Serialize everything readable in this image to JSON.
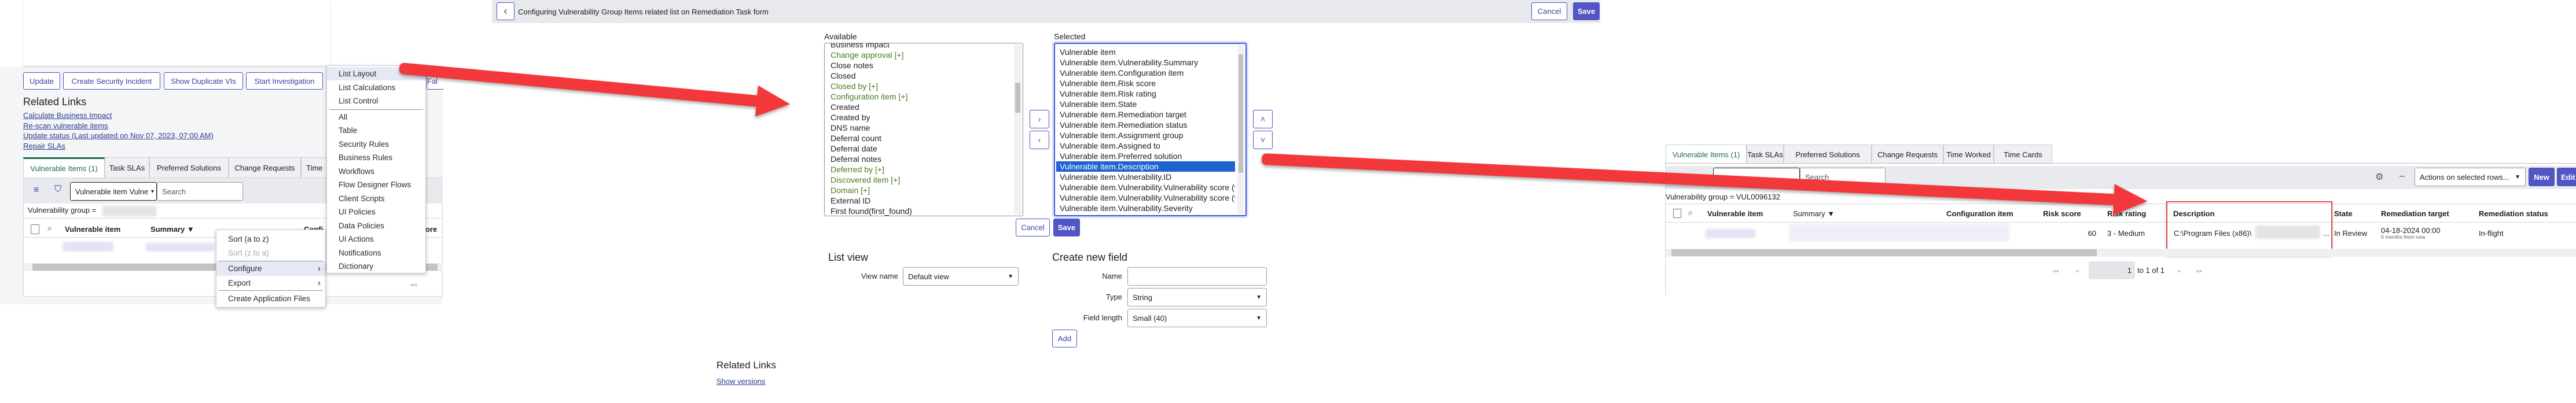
{
  "colors": {
    "accent": "#5256c4",
    "link": "#2d3b8e",
    "active_tab": "#1f6b4f",
    "reference_field": "#4b7a1e",
    "selection": "#1e63cf",
    "annotation": "#f2373b"
  },
  "left_panel": {
    "buttons": [
      "Update",
      "Create Security Incident",
      "Show Duplicate VIs",
      "Start Investigation",
      "Fal"
    ],
    "related_links_heading": "Related Links",
    "related_links": [
      "Calculate Business Impact",
      "Re-scan vulnerable items",
      "Update status (Last updated on Nov 07, 2023, 07:00 AM)",
      "Repair SLAs"
    ],
    "tabs": [
      "Vulnerable Items (1)",
      "Task SLAs",
      "Preferred Solutions",
      "Change Requests",
      "Time"
    ],
    "search_field": "Vulnerable item Vulne",
    "search_placeholder": "Search",
    "filter_label": "Vulnerability group =",
    "columns": [
      "Vulnerable item",
      "Summary ▼",
      "Confi",
      "ore"
    ],
    "context_menu": {
      "items": [
        "Sort (a to z)",
        "Sort (z to a)",
        "Configure",
        "Export",
        "Create Application Files"
      ],
      "chevron": "›"
    },
    "submenu": {
      "items": [
        "List Layout",
        "List Calculations",
        "List Control",
        "All",
        "Table",
        "Security Rules",
        "Business Rules",
        "Workflows",
        "Flow Designer Flows",
        "Client Scripts",
        "UI Policies",
        "Data Policies",
        "UI Actions",
        "Notifications",
        "Dictionary"
      ]
    }
  },
  "config_panel": {
    "back_icon": "‹",
    "title": "Configuring Vulnerability Group Items related list on Remediation Task form",
    "cancel": "Cancel",
    "save": "Save",
    "available_label": "Available",
    "available": [
      {
        "label": "Business impact",
        "ref": false
      },
      {
        "label": "Change approval [+]",
        "ref": true
      },
      {
        "label": "Close notes",
        "ref": false
      },
      {
        "label": "Closed",
        "ref": false
      },
      {
        "label": "Closed by [+]",
        "ref": true
      },
      {
        "label": "Configuration item [+]",
        "ref": true
      },
      {
        "label": "Created",
        "ref": false
      },
      {
        "label": "Created by",
        "ref": false
      },
      {
        "label": "DNS name",
        "ref": false
      },
      {
        "label": "Deferral count",
        "ref": false
      },
      {
        "label": "Deferral date",
        "ref": false
      },
      {
        "label": "Deferral notes",
        "ref": false
      },
      {
        "label": "Deferred by [+]",
        "ref": true
      },
      {
        "label": "Discovered item [+]",
        "ref": true
      },
      {
        "label": "Domain [+]",
        "ref": true
      },
      {
        "label": "External ID",
        "ref": false
      },
      {
        "label": "First found(first_found)",
        "ref": false
      }
    ],
    "selected_label": "Selected",
    "selected": [
      "Vulnerable item",
      "Vulnerable item.Vulnerability.Summary",
      "Vulnerable item.Configuration item",
      "Vulnerable item.Risk score",
      "Vulnerable item.Risk rating",
      "Vulnerable item.State",
      "Vulnerable item.Remediation target",
      "Vulnerable item.Remediation status",
      "Vulnerable item.Assignment group",
      "Vulnerable item.Assigned to",
      "Vulnerable item.Preferred solution",
      "Vulnerable item.Description",
      "Vulnerable item.Vulnerability.ID",
      "Vulnerable item.Vulnerability.Vulnerability score (v",
      "Vulnerable item.Vulnerability.Vulnerability score (v",
      "Vulnerable item.Vulnerability.Severity"
    ],
    "selected_index": 11,
    "move_right": "›",
    "move_left": "‹",
    "move_up": "˄",
    "move_down": "˅",
    "list_view_heading": "List view",
    "view_name_label": "View name",
    "view_name_value": "Default view",
    "create_field_heading": "Create new field",
    "name_label": "Name",
    "name_value": "",
    "type_label": "Type",
    "type_value": "String",
    "field_length_label": "Field length",
    "field_length_value": "Small (40)",
    "add": "Add",
    "related_links_heading": "Related Links",
    "show_versions": "Show versions"
  },
  "result_panel": {
    "tabs": [
      "Vulnerable Items (1)",
      "Task SLAs",
      "Preferred Solutions",
      "Change Requests",
      "Time Worked",
      "Time Cards"
    ],
    "search_placeholder": "Search",
    "actions_select": "Actions on selected rows...",
    "new": "New",
    "edit": "Edit",
    "filter_label": "Vulnerability group = VUL0096132",
    "columns": [
      "Vulnerable item",
      "Summary ▼",
      "Configuration item",
      "Risk score",
      "Risk rating",
      "Description",
      "State",
      "Remediation target",
      "Remediation status"
    ],
    "row": {
      "risk_score": "60",
      "risk_rating": "3 - Medium",
      "description": "C:\\Program Files (x86)\\",
      "ellipsis": "...",
      "state": "In Review",
      "remediation_target": "04-18-2024 00:00",
      "remediation_relative": "5 months from now",
      "remediation_status": "In-flight"
    },
    "pagination": {
      "page": "1",
      "range": "to 1 of 1"
    }
  }
}
